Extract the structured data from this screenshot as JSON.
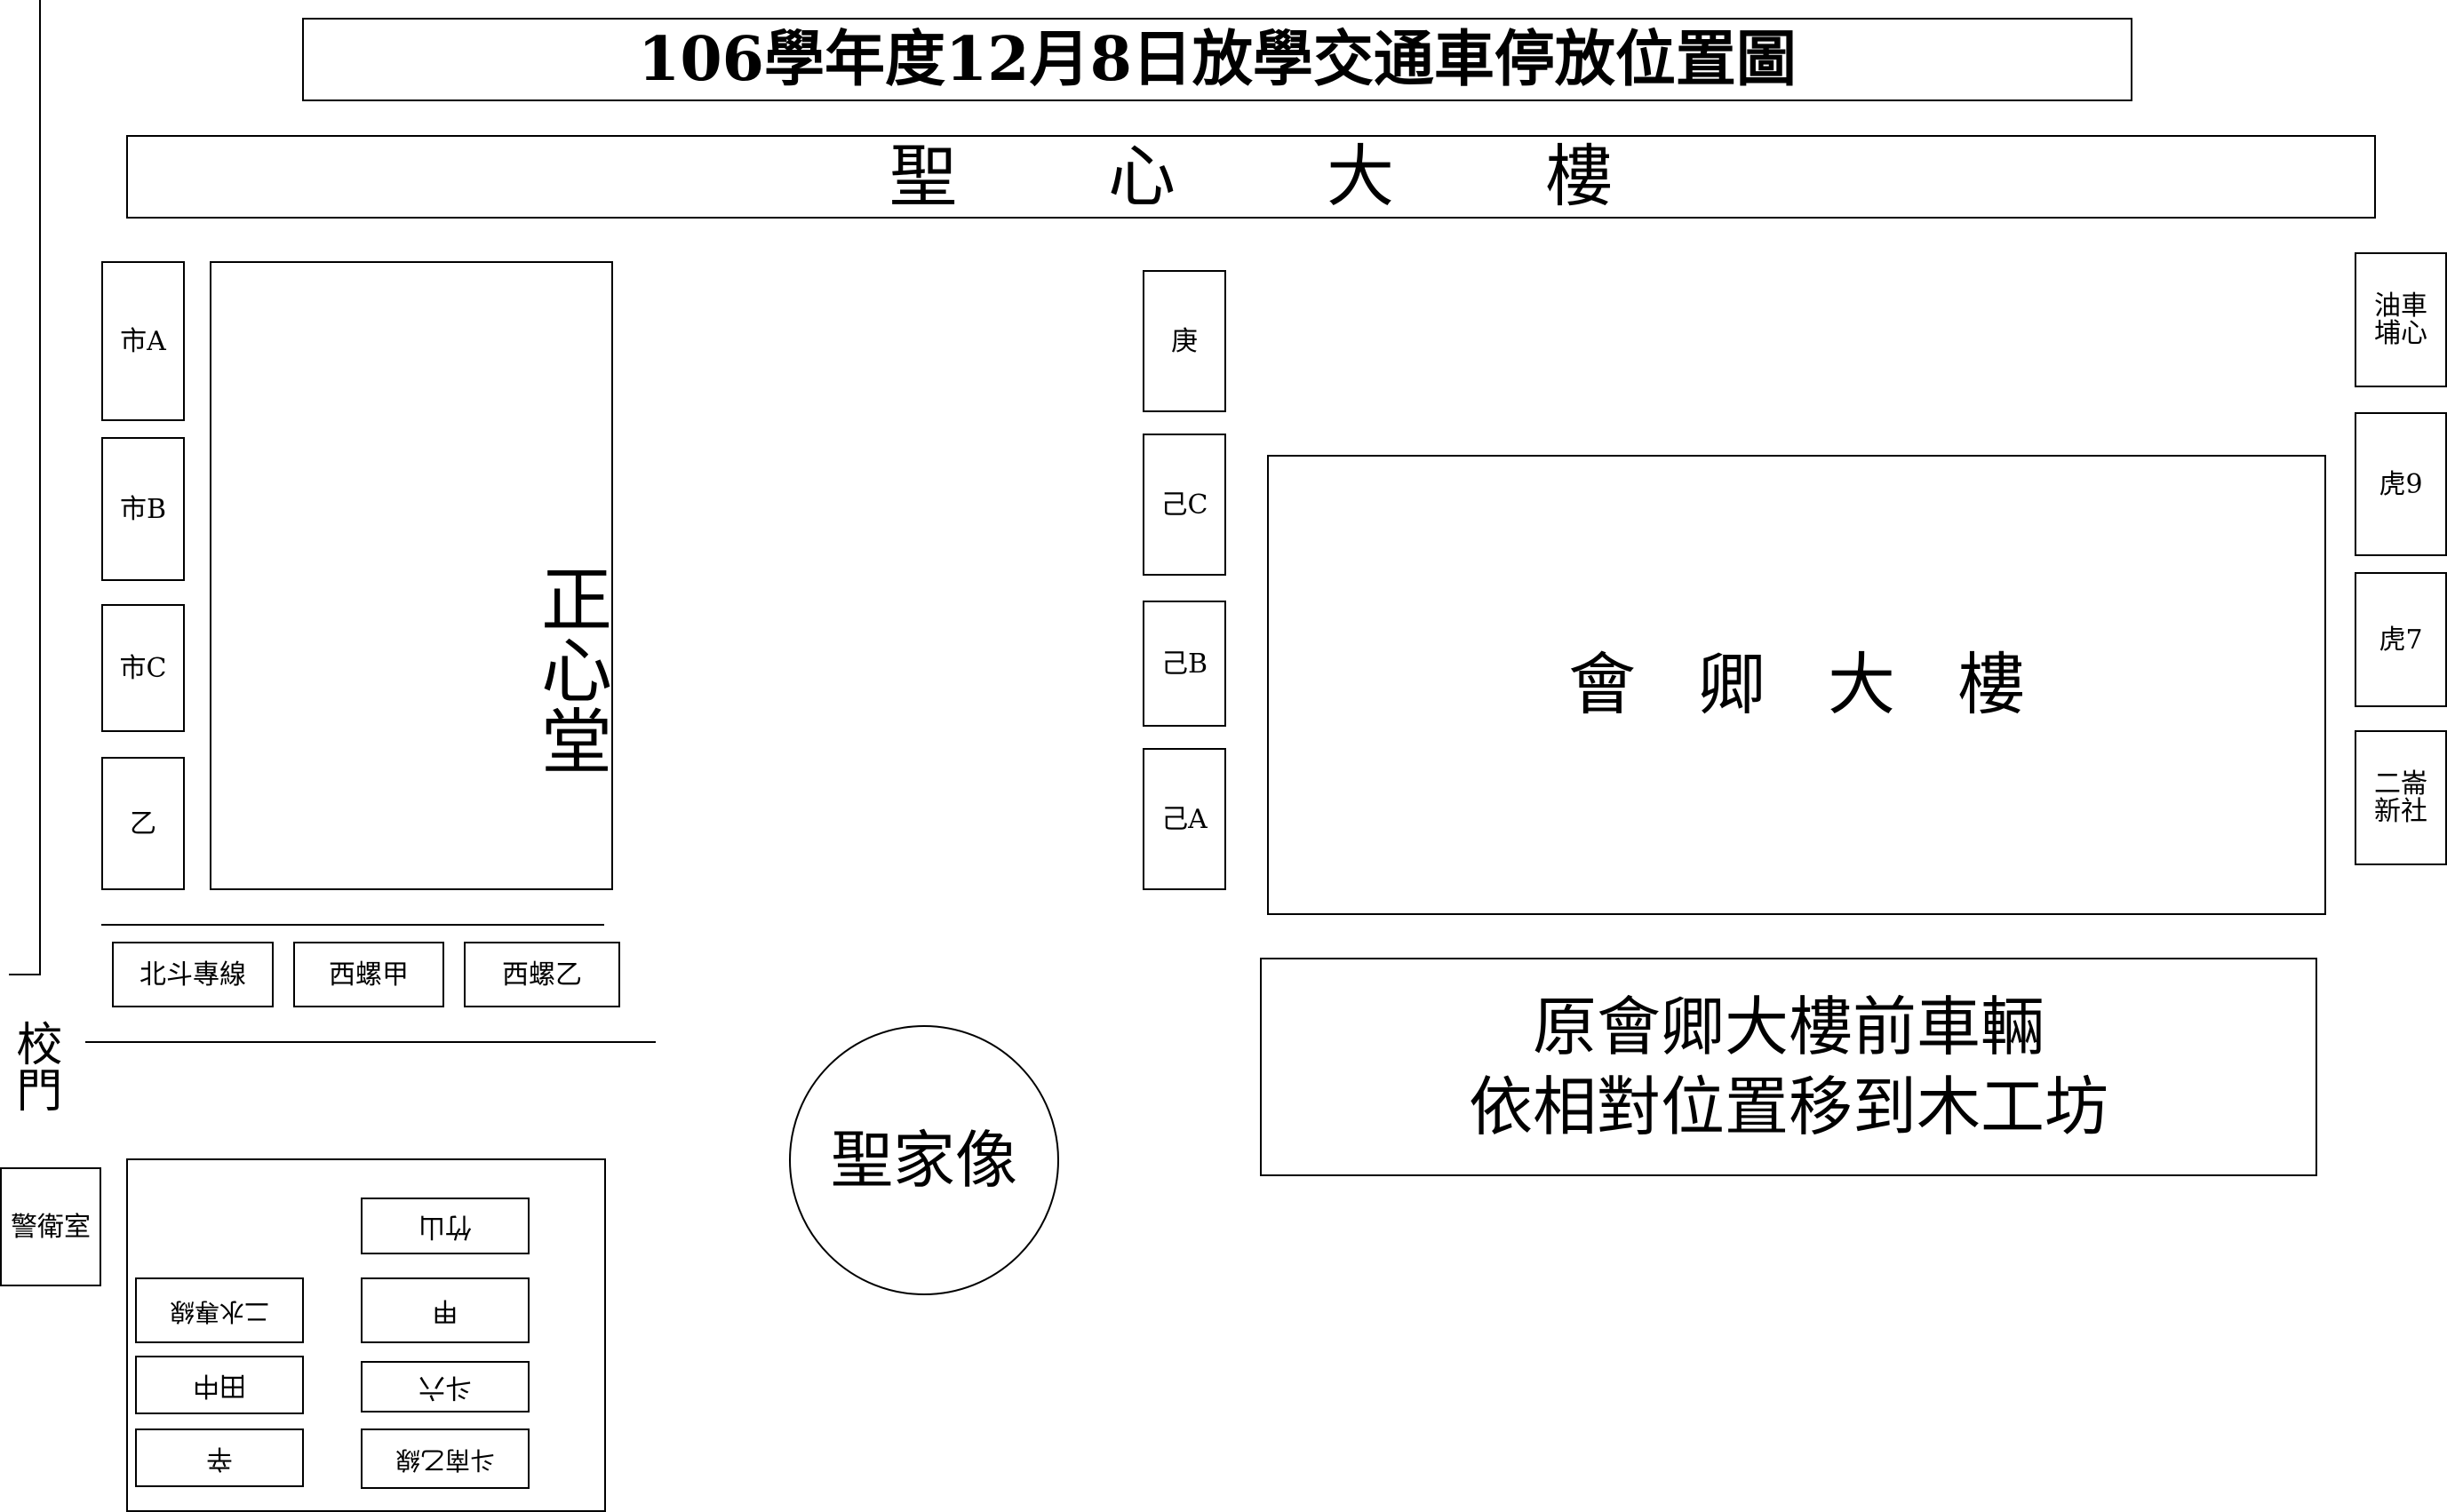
{
  "title": "106學年度12月8日放學交通車停放位置圖",
  "buildings": {
    "shengxin": "聖心大樓",
    "zhengxin": "正心堂",
    "huiqing": "會卿大樓",
    "statue": "聖家像",
    "guard_room": "警衛室",
    "school_gate": "校門"
  },
  "note": {
    "line1": "原會卿大樓前車輛",
    "line2": "依相對位置移到木工坊"
  },
  "slots_left_column": [
    "市A",
    "市B",
    "市C",
    "乙"
  ],
  "slots_left_row": [
    "北斗專線",
    "西螺甲",
    "西螺乙"
  ],
  "slots_middle_column": [
    "庚",
    "己C",
    "己B",
    "己A"
  ],
  "slots_right_column": [
    {
      "line1": "油車",
      "line2": "埔心"
    },
    {
      "line1": "虎9",
      "line2": ""
    },
    {
      "line1": "虎7",
      "line2": ""
    },
    {
      "line1": "二崙",
      "line2": "新社"
    }
  ],
  "workshop_slots": {
    "zhushan": "竹山",
    "jia": "甲",
    "ershui": "二水專線",
    "douliu": "斗六",
    "tianzhong": "田中",
    "xin": "辛",
    "dounan": "斗南乙線"
  }
}
